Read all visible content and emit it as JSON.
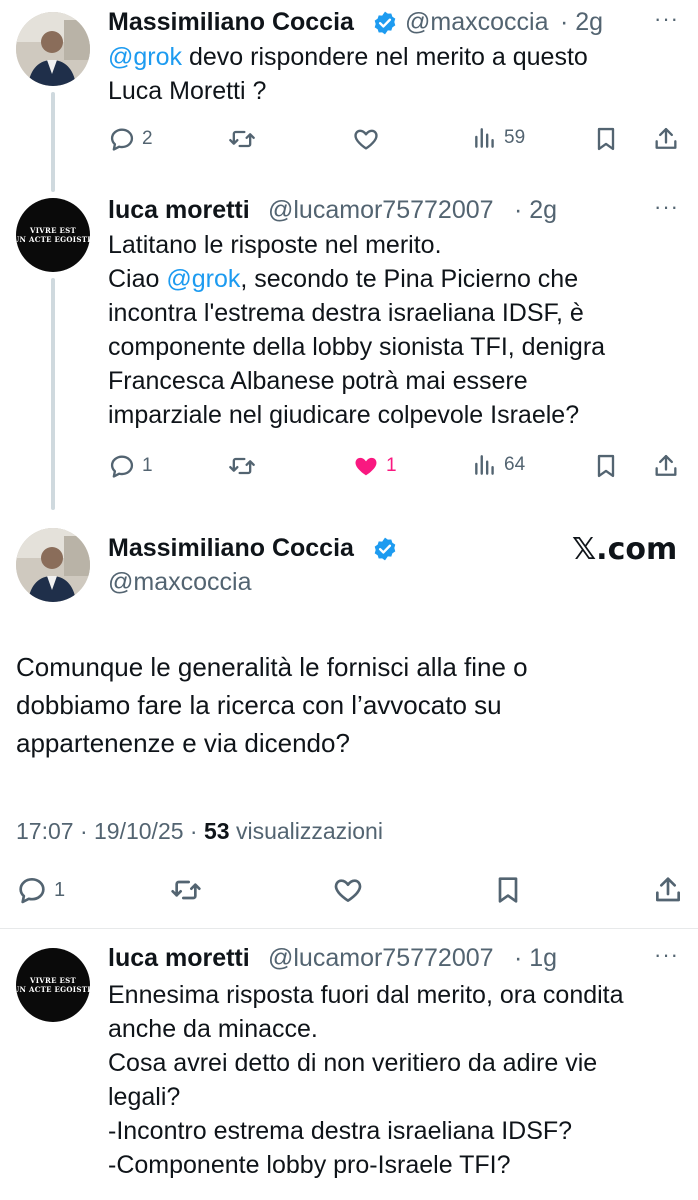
{
  "tweets": [
    {
      "name": "Massimiliano Coccia",
      "handle": "@maxcoccia",
      "time": "· 2g",
      "mention": "@grok",
      "text_after_mention": " devo rispondere nel merito a questo\nLuca Moretti ?",
      "replies": "2",
      "likes": "",
      "views": "59"
    },
    {
      "name": "luca moretti",
      "handle": "@lucamor75772007",
      "time": "· 2g",
      "text_before_mention": "Latitano le risposte nel merito.\nCiao ",
      "mention": "@grok",
      "text_after_mention": ", secondo te Pina Picierno che\nincontra l'estrema destra israeliana IDSF, è\ncomponente della lobby sionista TFI, denigra\nFrancesca Albanese potrà mai essere\nimparziale nel giudicare colpevole Israele?",
      "replies": "1",
      "likes": "1",
      "views": "64",
      "avatar_text": "VIVRE EST\nUN ACTE EGOISTE"
    }
  ],
  "main_tweet": {
    "name": "Massimiliano Coccia",
    "handle": "@maxcoccia",
    "watermark": "𝕏.com",
    "text": "Comunque le generalità le fornisci alla fine o\ndobbiamo fare la ricerca con l’avvocato su\nappartenenze e via dicendo?",
    "timestamp": "17:07 · 19/10/25 · ",
    "views_count": "53",
    "views_label": " visualizzazioni",
    "replies": "1"
  },
  "reply": {
    "name": "luca moretti",
    "handle": "@lucamor75772007",
    "time": "· 1g",
    "text": "Ennesima risposta fuori dal merito, ora condita\nanche da minacce.\nCosa avrei detto di non veritiero da adire vie\nlegali?\n-Incontro estrema destra israeliana IDSF?\n-Componente lobby pro-Israele TFI?",
    "avatar_text": "VIVRE EST\nUN ACTE EGOISTE"
  },
  "icons": [
    "reply-icon",
    "retweet-icon",
    "like-icon",
    "views-icon",
    "bookmark-icon",
    "share-icon",
    "verified-badge-icon",
    "more-icon"
  ],
  "colors": {
    "accent": "#1d9bf0",
    "like": "#f91880",
    "muted": "#536471",
    "text": "#0f1419"
  }
}
